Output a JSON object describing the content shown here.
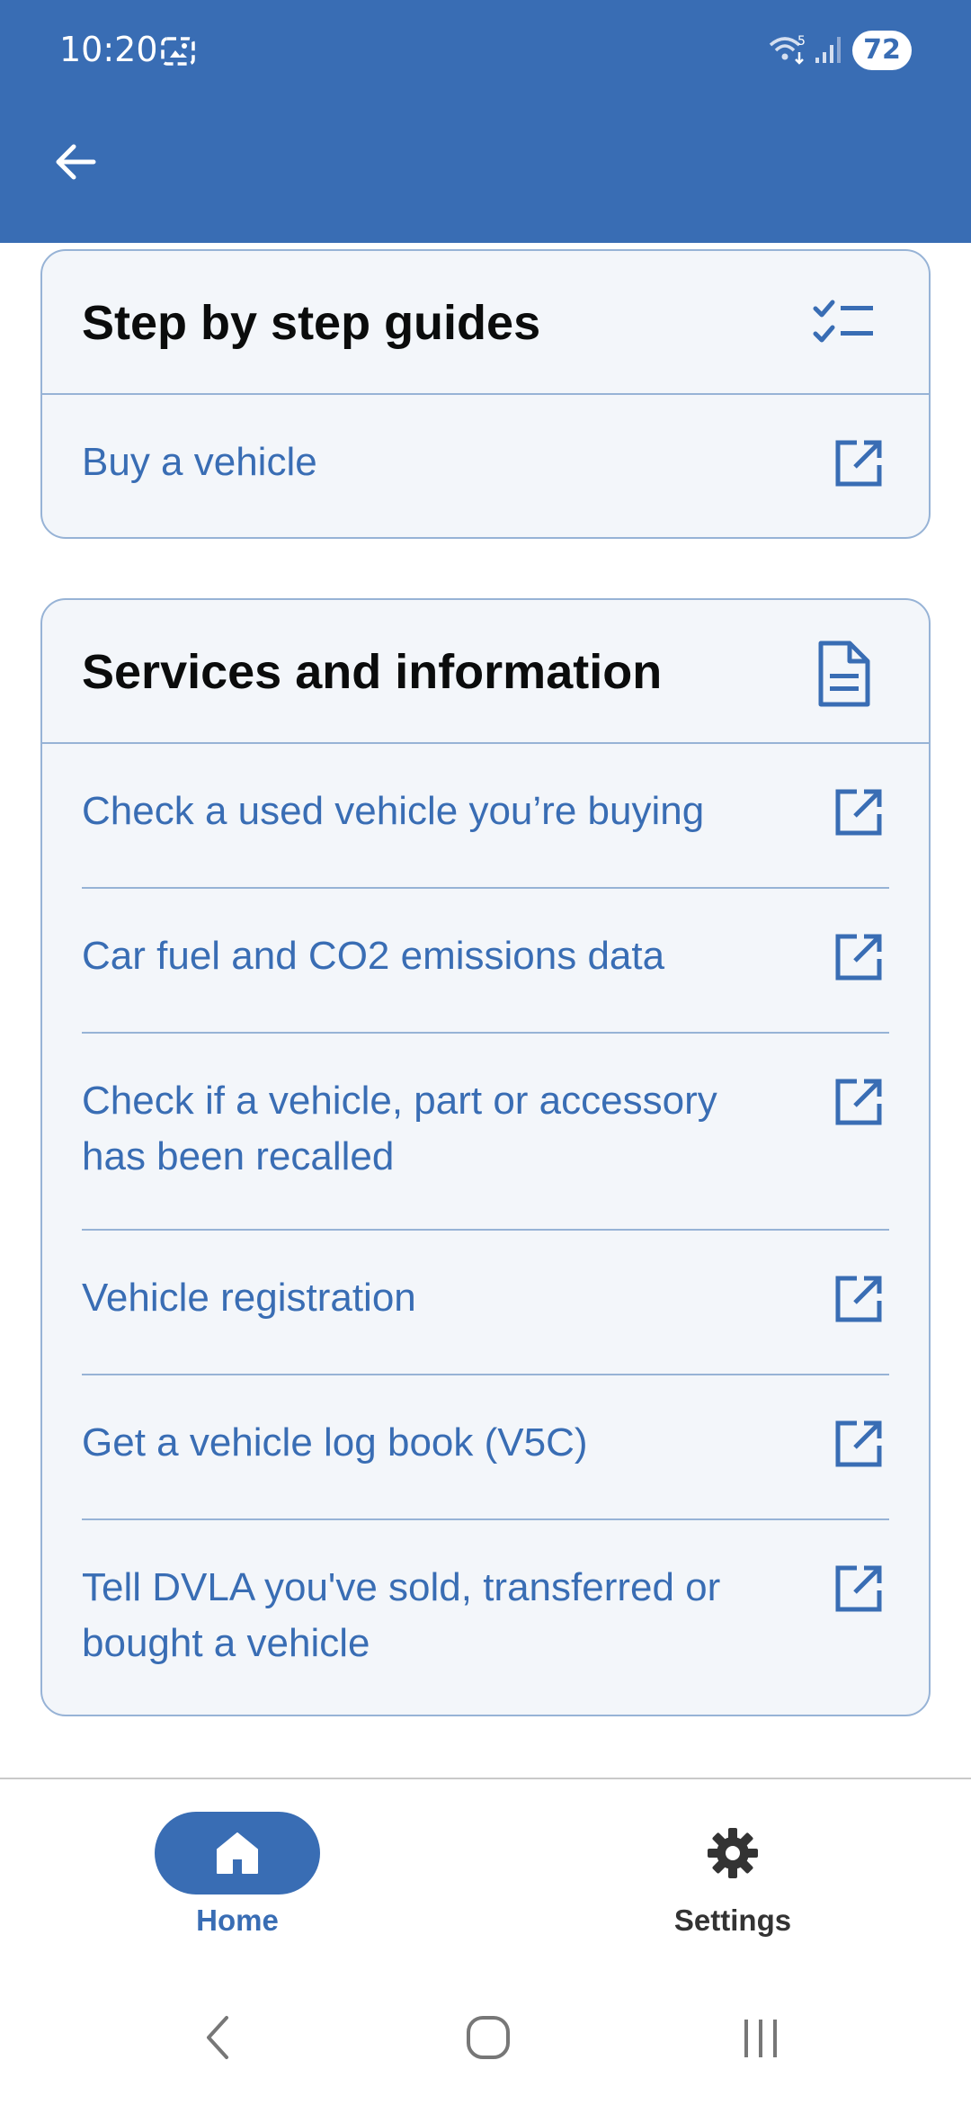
{
  "status_bar": {
    "time": "10:20",
    "battery": "72",
    "icons": [
      "photo-icon",
      "wifi-icon",
      "signal-icon"
    ]
  },
  "header": {
    "back_icon": "arrow-left-icon"
  },
  "step_guides": {
    "title": "Step by step guides",
    "icon": "checklist-icon",
    "items": [
      {
        "label": "Buy a vehicle",
        "icon": "external-link-icon"
      }
    ]
  },
  "services": {
    "title": "Services and information",
    "icon": "document-icon",
    "items": [
      {
        "label": "Check a used vehicle you’re buying",
        "icon": "external-link-icon"
      },
      {
        "label": "Car fuel and CO2 emissions data",
        "icon": "external-link-icon"
      },
      {
        "label": "Check if a vehicle, part or accessory has been recalled",
        "icon": "external-link-icon"
      },
      {
        "label": "Vehicle registration",
        "icon": "external-link-icon"
      },
      {
        "label": "Get a vehicle log book (V5C)",
        "icon": "external-link-icon"
      },
      {
        "label": "Tell DVLA you've sold, transferred or bought a vehicle",
        "icon": "external-link-icon"
      }
    ]
  },
  "bottom_nav": {
    "items": [
      {
        "label": "Home",
        "icon": "home-icon",
        "selected": true
      },
      {
        "label": "Settings",
        "icon": "gear-icon",
        "selected": false
      }
    ]
  },
  "system_nav": {
    "icons": [
      "back-icon",
      "home-circle-icon",
      "recents-icon"
    ]
  },
  "colors": {
    "primary": "#396db4",
    "card_background": "#f3f6fa",
    "card_border": "#97b3d6",
    "title_text": "#0b0c0c"
  }
}
